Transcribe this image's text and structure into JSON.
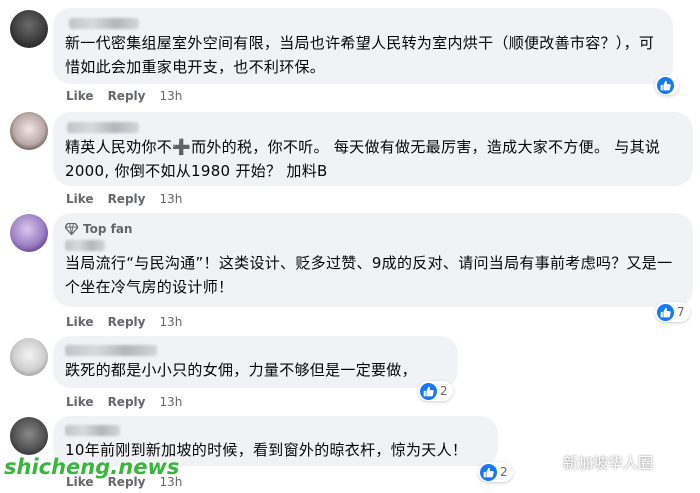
{
  "comments": [
    {
      "text": "新一代密集组屋室外空间有限，当局也许希望人民转为室内烘干（顺便改善市容？），可惜如此会加重家电开支，也不利环保。",
      "like": "Like",
      "reply": "Reply",
      "time": "13h",
      "reaction_count": ""
    },
    {
      "text": "精英人民劝你不➕而外的税，你不听。 每天做有做无最厉害，造成大家不方便。 与其说2000, 你倒不如从1980 开始？ 加料B",
      "like": "Like",
      "reply": "Reply",
      "time": "13h",
      "reaction_count": ""
    },
    {
      "badge": "Top fan",
      "text": "当局流行“与民沟通”！这类设计、贬多过赞、9成的反对、请问当局有事前考虑吗？又是一个坐在冷气房的设计师！",
      "like": "Like",
      "reply": "Reply",
      "time": "13h",
      "reaction_count": "7"
    },
    {
      "text": "跌死的都是小小只的女佣，力量不够但是一定要做，",
      "like": "Like",
      "reply": "Reply",
      "time": "13h",
      "reaction_count": "2"
    },
    {
      "text": "10年前刚到新加坡的时候，看到窗外的晾衣杆，惊为天人！",
      "like": "Like",
      "reply": "Reply",
      "time": "13h",
      "reaction_count": "2"
    }
  ],
  "watermark": "shicheng.news",
  "wechat_account": "新加坡华人圈",
  "colors": {
    "bubble": "#f0f2f5",
    "like_blue": "#1877f2",
    "meta_gray": "#65676b",
    "watermark_green": "#38b63e"
  },
  "icons": {
    "reaction": "like-thumb-icon",
    "badge": "diamond-icon",
    "wechat": "wechat-icon"
  }
}
